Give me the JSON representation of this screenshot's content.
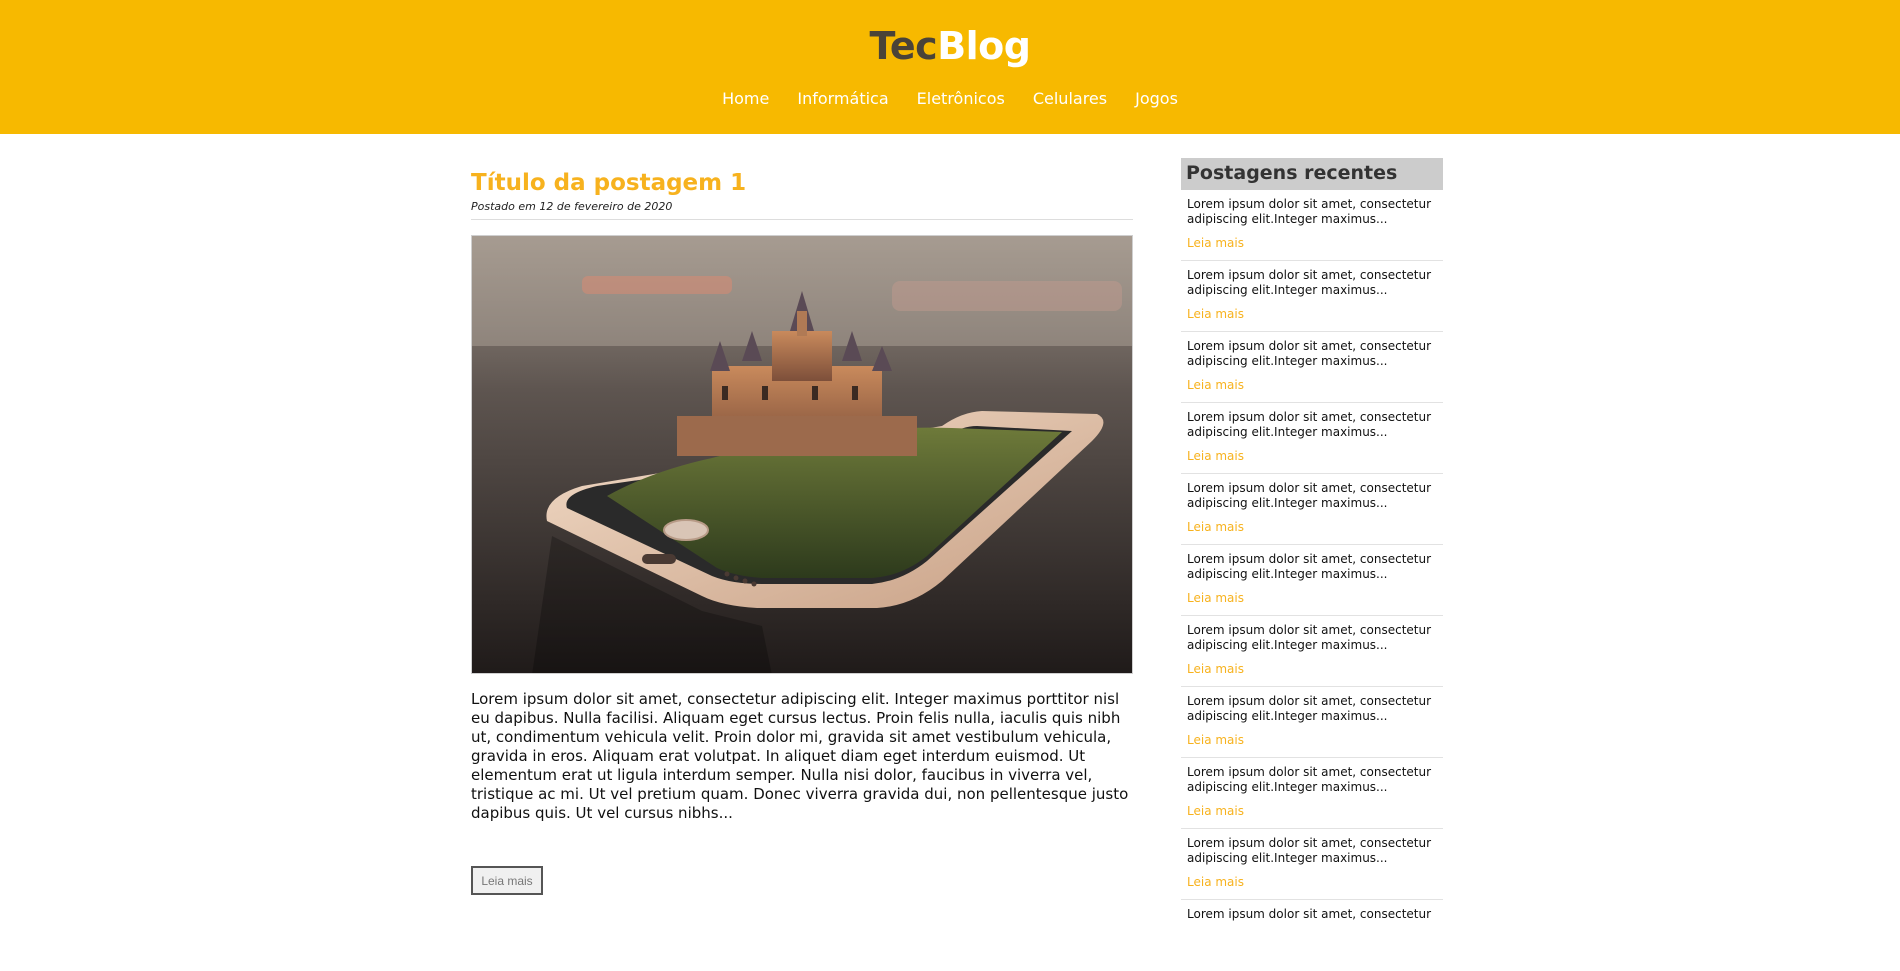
{
  "header": {
    "logo_part1": "Tec",
    "logo_part2": "Blog",
    "nav": [
      "Home",
      "Informática",
      "Eletrônicos",
      "Celulares",
      "Jogos"
    ]
  },
  "post": {
    "title": "Título da postagem 1",
    "date": "Postado em 12 de fevereiro de 2020",
    "image_alt": "castle-on-phone-image",
    "text": "Lorem ipsum dolor sit amet, consectetur adipiscing elit. Integer maximus porttitor nisl eu dapibus. Nulla facilisi. Aliquam eget cursus lectus. Proin felis nulla, iaculis quis nibh ut, condimentum vehicula velit. Proin dolor mi, gravida sit amet vestibulum vehicula, gravida in eros. Aliquam erat volutpat. In aliquet diam eget interdum euismod. Ut elementum erat ut ligula interdum semper. Nulla nisi dolor, faucibus in viverra vel, tristique ac mi. Ut vel pretium quam. Donec viverra gravida dui, non pellentesque justo dapibus quis. Ut vel cursus nibhs...",
    "read_more": "Leia mais"
  },
  "sidebar": {
    "title": "Postagens recentes",
    "items": [
      {
        "text": "Lorem ipsum dolor sit amet, consectetur adipiscing elit.Integer maximus...",
        "link": "Leia mais"
      },
      {
        "text": "Lorem ipsum dolor sit amet, consectetur adipiscing elit.Integer maximus...",
        "link": "Leia mais"
      },
      {
        "text": "Lorem ipsum dolor sit amet, consectetur adipiscing elit.Integer maximus...",
        "link": "Leia mais"
      },
      {
        "text": "Lorem ipsum dolor sit amet, consectetur adipiscing elit.Integer maximus...",
        "link": "Leia mais"
      },
      {
        "text": "Lorem ipsum dolor sit amet, consectetur adipiscing elit.Integer maximus...",
        "link": "Leia mais"
      },
      {
        "text": "Lorem ipsum dolor sit amet, consectetur adipiscing elit.Integer maximus...",
        "link": "Leia mais"
      },
      {
        "text": "Lorem ipsum dolor sit amet, consectetur adipiscing elit.Integer maximus...",
        "link": "Leia mais"
      },
      {
        "text": "Lorem ipsum dolor sit amet, consectetur adipiscing elit.Integer maximus...",
        "link": "Leia mais"
      },
      {
        "text": "Lorem ipsum dolor sit amet, consectetur adipiscing elit.Integer maximus...",
        "link": "Leia mais"
      },
      {
        "text": "Lorem ipsum dolor sit amet, consectetur adipiscing elit.Integer maximus...",
        "link": "Leia mais"
      },
      {
        "text": "Lorem ipsum dolor sit amet, consectetur",
        "link": ""
      }
    ]
  },
  "colors": {
    "brand_yellow": "#f7b900",
    "title_orange": "#f7b21e",
    "sidebar_gray": "#cccccc"
  }
}
